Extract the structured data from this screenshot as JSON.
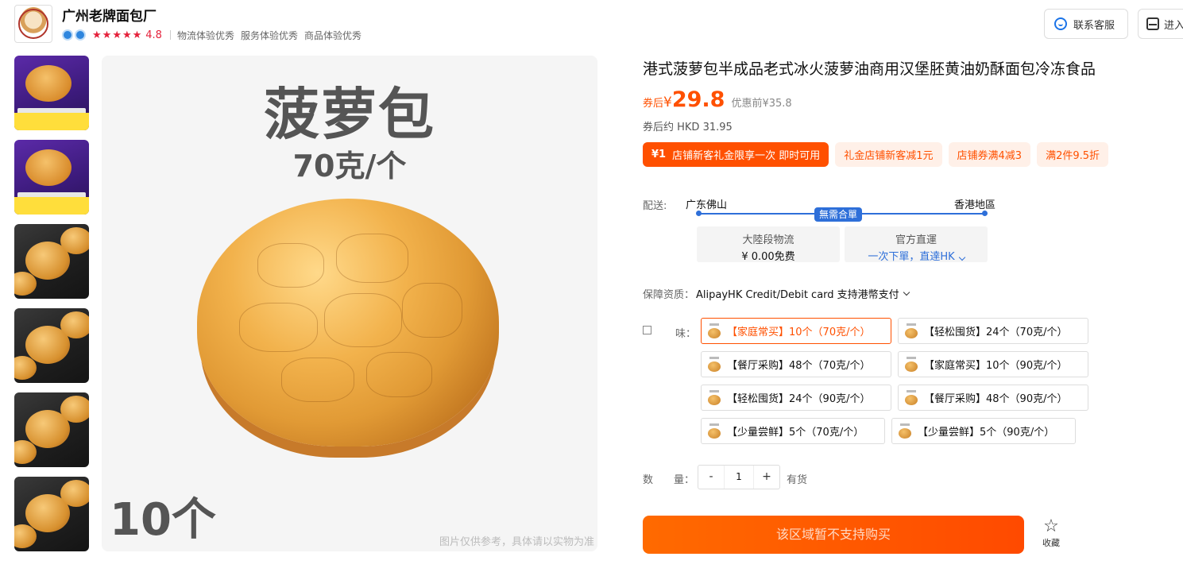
{
  "shop": {
    "name": "广州老牌面包厂",
    "rating": "4.8",
    "metrics": [
      "物流体验优秀",
      "服务体验优秀",
      "商品体验优秀"
    ]
  },
  "top_actions": {
    "service_label": "联系客服",
    "enter_label": "进入"
  },
  "gallery": {
    "main_title": "菠萝包",
    "main_subtitle": "70克/个",
    "main_count": "10个",
    "main_note": "图片仅供参考，具体请以实物为准"
  },
  "product": {
    "title": "港式菠萝包半成品老式冰火菠萝油商用汉堡胚黄油奶酥面包冷冻食品",
    "price_label": "券后",
    "price_currency": "¥",
    "price_value": "29.8",
    "original_price": "优惠前¥35.8",
    "hkd_price": "券后约 HKD 31.95"
  },
  "coupons": {
    "primary_amount": "¥1",
    "primary_text": "店铺新客礼金限享一次 即时可用",
    "items": [
      "礼金店铺新客减1元",
      "店铺券满4减3",
      "满2件9.5折"
    ]
  },
  "shipping": {
    "label": "配送:",
    "from": "广东佛山",
    "to": "香港地區",
    "badge": "無需合單",
    "option_a_title": "大陸段物流",
    "option_a_value": "¥ 0.00免费",
    "option_b_title": "官方直運",
    "option_b_value": "一次下單，直達HK"
  },
  "guarantee": {
    "label": "保障资质：",
    "value": "AlipayHK Credit/Debit card 支持港幣支付"
  },
  "flavor": {
    "label": "味：",
    "options": [
      "【家庭常买】10个（70克/个）",
      "【轻松囤货】24个（70克/个）",
      "【餐厅采购】48个（70克/个）",
      "【家庭常买】10个（90克/个）",
      "【轻松囤货】24个（90克/个）",
      "【餐厅采购】48个（90克/个）",
      "【少量尝鲜】5个（70克/个）",
      "【少量尝鲜】5个（90克/个）"
    ],
    "selected_index": 0
  },
  "quantity": {
    "label": "数　　量：",
    "minus": "-",
    "value": "1",
    "plus": "+",
    "stock": "有货"
  },
  "buy_button": "该区域暂不支持购买",
  "favorite_label": "收藏",
  "colors": {
    "accent": "#ff5000",
    "blue": "#2e6fd9",
    "rating": "#e5213b"
  }
}
